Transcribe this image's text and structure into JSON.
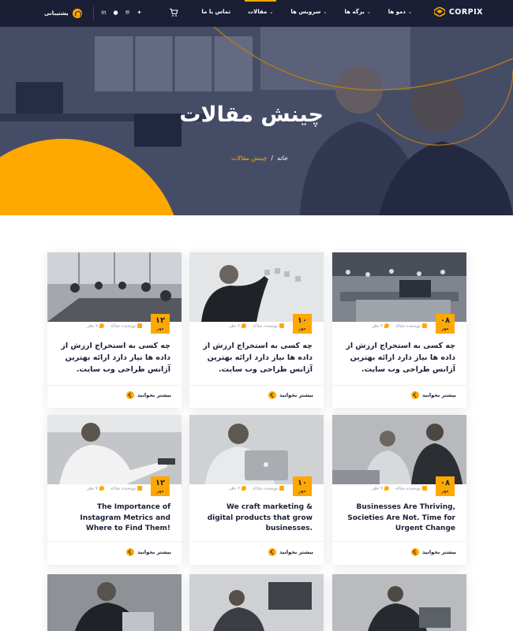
{
  "header": {
    "logo": "CORPIX",
    "nav": [
      {
        "label": "دمو ها",
        "dropdown": true,
        "active": false
      },
      {
        "label": "برگه ها",
        "dropdown": true,
        "active": false
      },
      {
        "label": "سرویس ها",
        "dropdown": true,
        "active": false
      },
      {
        "label": "مقالات",
        "dropdown": true,
        "active": true
      },
      {
        "label": "تماس با ما",
        "dropdown": false,
        "active": false
      }
    ],
    "social_icons": [
      "twitter-icon",
      "pinterest-icon",
      "github-icon",
      "linkedin-icon"
    ],
    "support_label": "پشتیبانی",
    "colors": {
      "bg": "#1a1f36",
      "accent": "#ffa800"
    }
  },
  "hero": {
    "title": "چینش مقالات",
    "breadcrumb": {
      "home": "خانه",
      "separator": "/",
      "current": "چینش مقالات"
    }
  },
  "cards": [
    {
      "day": "۰۸",
      "month": "مهر",
      "author": "نویسنده مقاله",
      "comments": "۷ نظر",
      "title": "چه کسی به استخراج ارزش از داده ها نیاز دارد ارائه بهترین آژانس طراحی وب سایت.",
      "more": "بیشتر بخوانید"
    },
    {
      "day": "۱۰",
      "month": "مهر",
      "author": "نویسنده مقاله",
      "comments": "۷ نظر",
      "title": "چه کسی به استخراج ارزش از داده ها نیاز دارد ارائه بهترین آژانس طراحی وب سایت.",
      "more": "بیشتر بخوانید"
    },
    {
      "day": "۱۲",
      "month": "مهر",
      "author": "نویسنده مقاله",
      "comments": "۷ نظر",
      "title": "چه کسی به استخراج ارزش از داده ها نیاز دارد ارائه بهترین آژانس طراحی وب سایت.",
      "more": "بیشتر بخوانید"
    },
    {
      "day": "۰۸",
      "month": "مهر",
      "author": "نویسنده مقاله",
      "comments": "۷ نظر",
      "title": "Businesses Are Thriving, Societies Are Not. Time for Urgent Change",
      "more": "بیشتر بخوانید"
    },
    {
      "day": "۱۰",
      "month": "مهر",
      "author": "نویسنده مقاله",
      "comments": "۷ نظر",
      "title": "We craft marketing & digital products that grow businesses.",
      "more": "بیشتر بخوانید"
    },
    {
      "day": "۱۲",
      "month": "مهر",
      "author": "نویسنده مقاله",
      "comments": "۷ نظر",
      "title": "The Importance of Instagram Metrics and Where to Find Them!",
      "more": "بیشتر بخوانید"
    }
  ]
}
